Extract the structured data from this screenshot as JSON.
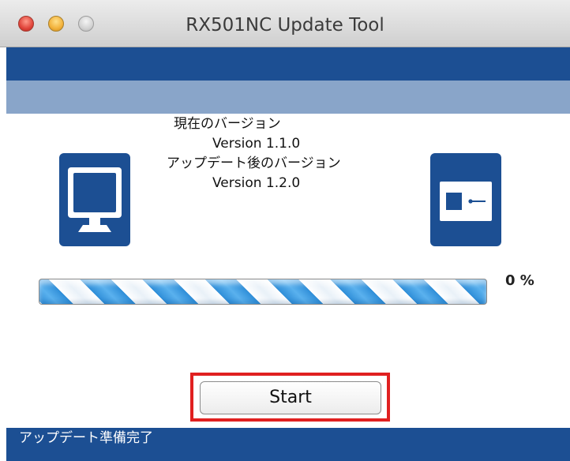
{
  "window": {
    "title": "RX501NC Update Tool"
  },
  "versions": {
    "current_label": "現在のバージョン",
    "current_value": "Version 1.1.0",
    "after_label": "アップデート後のバージョン",
    "after_value": "Version 1.2.0"
  },
  "progress": {
    "percent_text": "0 %",
    "value": 0
  },
  "actions": {
    "start_label": "Start"
  },
  "status": {
    "text": "アップデート準備完了"
  },
  "icons": {
    "computer": "monitor-icon",
    "device": "device-icon"
  },
  "colors": {
    "brand_dark": "#1c4f93",
    "brand_light": "#89a5c9",
    "highlight": "#e02020",
    "progress_blue": "#2f8ed8"
  }
}
